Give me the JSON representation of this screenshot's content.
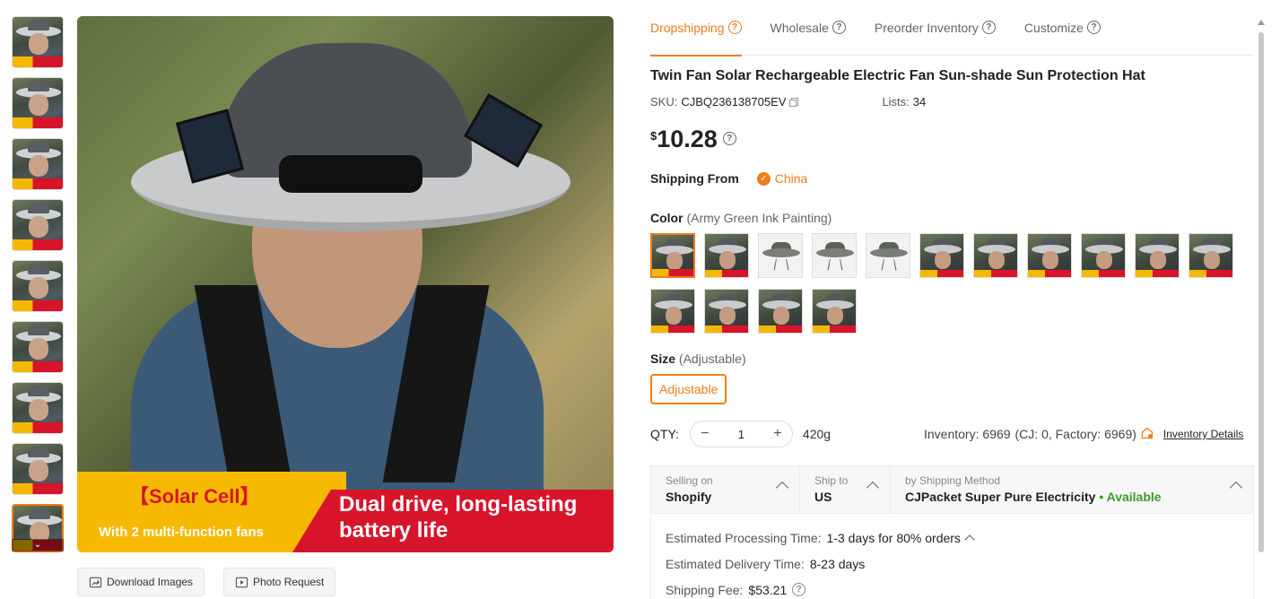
{
  "gallery": {
    "thumb_count": 9,
    "active_thumb": 8,
    "banner_title": "【Solar Cell】",
    "banner_sub": "With 2 multi-function fans",
    "banner_big": "Dual drive, long-lasting battery life",
    "download_label": "Download Images",
    "photo_request_label": "Photo Request",
    "more_icon": "chevron-down-icon"
  },
  "tabs": [
    {
      "label": "Dropshipping",
      "active": true
    },
    {
      "label": "Wholesale",
      "active": false
    },
    {
      "label": "Preorder Inventory",
      "active": false
    },
    {
      "label": "Customize",
      "active": false
    }
  ],
  "product": {
    "title": "Twin Fan Solar Rechargeable Electric Fan Sun-shade Sun Protection Hat",
    "sku_label": "SKU:",
    "sku": "CJBQ236138705EV",
    "lists_label": "Lists:",
    "lists": "34",
    "currency": "$",
    "price": "10.28"
  },
  "shipping_from": {
    "label": "Shipping From",
    "country": "China"
  },
  "color": {
    "label": "Color",
    "selected": "(Army Green Ink Painting)",
    "swatch_count": 15,
    "selected_index": 0,
    "light_swatches": [
      2,
      3,
      4
    ]
  },
  "size": {
    "label": "Size",
    "selected": "(Adjustable)",
    "option": "Adjustable"
  },
  "qty": {
    "label": "QTY:",
    "value": "1",
    "minus": "−",
    "plus": "+",
    "weight": "420g",
    "inventory": "Inventory: 6969",
    "inventory_breakdown": "(CJ: 0, Factory: 6969)",
    "inventory_details": "Inventory Details"
  },
  "shipping": {
    "selling_on_label": "Selling on",
    "selling_on": "Shopify",
    "ship_to_label": "Ship to",
    "ship_to": "US",
    "method_label": "by Shipping Method",
    "method": "CJPacket Super Pure Electricity",
    "availability": "• Available",
    "processing_label": "Estimated Processing Time:",
    "processing": "1-3 days for 80% orders",
    "delivery_label": "Estimated Delivery Time:",
    "delivery": "8-23 days",
    "fee_label": "Shipping Fee:",
    "fee": "$53.21"
  },
  "colors": {
    "accent": "#f07c1a",
    "available": "#3b9b2a",
    "banner_red": "#d8142b",
    "banner_yellow": "#f6b900"
  }
}
